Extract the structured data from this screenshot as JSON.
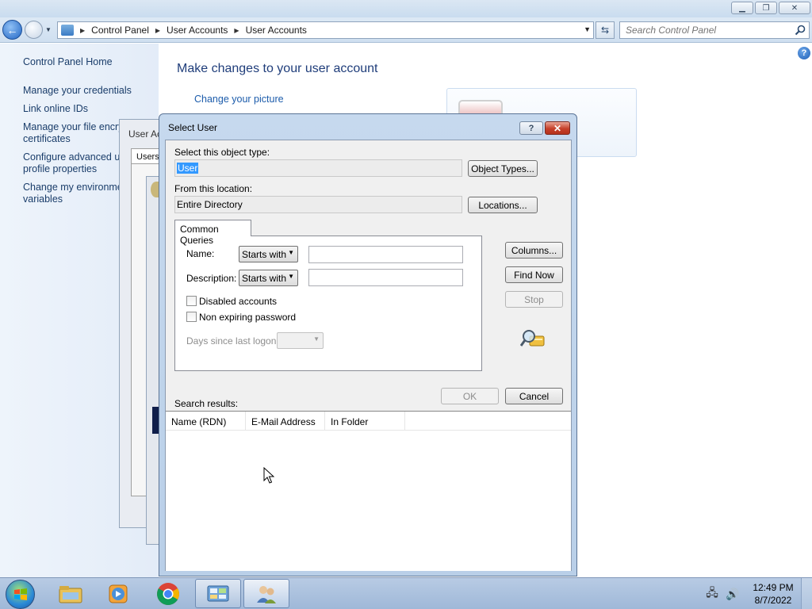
{
  "window": {
    "title_buttons": [
      "minimize",
      "maximize",
      "close"
    ]
  },
  "addressbar": {
    "breadcrumbs": [
      "Control Panel",
      "User Accounts",
      "User Accounts"
    ],
    "search_placeholder": "Search Control Panel"
  },
  "sidebar": {
    "items": [
      {
        "label": "Control Panel Home"
      },
      {
        "label": "Manage your credentials"
      },
      {
        "label": "Link online IDs"
      },
      {
        "label": "Manage your file encry"
      },
      {
        "label": "certificates"
      },
      {
        "label": "Configure advanced us"
      },
      {
        "label": "profile properties"
      },
      {
        "label": "Change my environme"
      },
      {
        "label": "variables"
      }
    ]
  },
  "content": {
    "heading": "Make changes to your user account",
    "change_picture_link": "Change your picture"
  },
  "bg_window": {
    "title": "User Ac",
    "tab": "Users"
  },
  "dialog": {
    "title": "Select User",
    "object_type_label": "Select this object type:",
    "object_type_value": "User",
    "object_types_button": "Object Types...",
    "location_label": "From this location:",
    "location_value": "Entire Directory",
    "locations_button": "Locations...",
    "tab_label": "Common Queries",
    "name_label": "Name:",
    "name_combo": "Starts with",
    "description_label": "Description:",
    "description_combo": "Starts with",
    "disabled_accounts_label": "Disabled accounts",
    "non_expiring_label": "Non expiring password",
    "days_label": "Days since last logon:",
    "columns_button": "Columns...",
    "find_now_button": "Find Now",
    "stop_button": "Stop",
    "ok_button": "OK",
    "cancel_button": "Cancel",
    "search_results_label": "Search results:",
    "result_columns": [
      "Name (RDN)",
      "E-Mail Address",
      "In Folder"
    ]
  },
  "taskbar": {
    "apps": [
      "windows-explorer",
      "media-player",
      "google-chrome",
      "control-panel",
      "user-accounts"
    ],
    "time": "12:49 PM",
    "date": "8/7/2022"
  }
}
